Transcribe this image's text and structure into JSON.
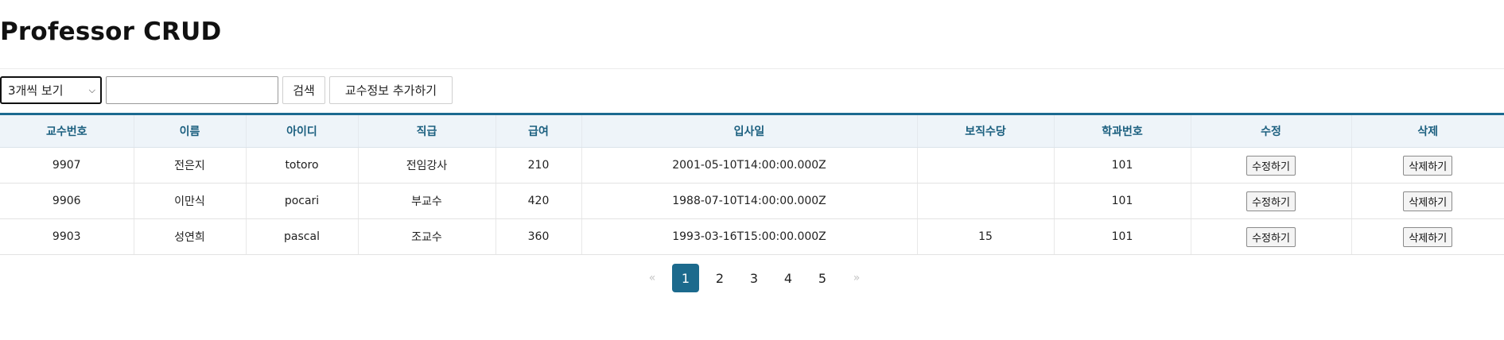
{
  "page": {
    "title": "Professor CRUD"
  },
  "toolbar": {
    "page_size": "3개씩 보기",
    "search_value": "",
    "search_label": "검색",
    "add_label": "교수정보 추가하기"
  },
  "table": {
    "columns": [
      "교수번호",
      "이름",
      "아이디",
      "직급",
      "급여",
      "입사일",
      "보직수당",
      "학과번호",
      "수정",
      "삭제"
    ],
    "rows": [
      {
        "id": "9907",
        "name": "전은지",
        "userid": "totoro",
        "position": "전임강사",
        "salary": "210",
        "hiredate": "2001-05-10T14:00:00.000Z",
        "comm": "",
        "deptno": "101",
        "edit": "수정하기",
        "delete": "삭제하기"
      },
      {
        "id": "9906",
        "name": "이만식",
        "userid": "pocari",
        "position": "부교수",
        "salary": "420",
        "hiredate": "1988-07-10T14:00:00.000Z",
        "comm": "",
        "deptno": "101",
        "edit": "수정하기",
        "delete": "삭제하기"
      },
      {
        "id": "9903",
        "name": "성연희",
        "userid": "pascal",
        "position": "조교수",
        "salary": "360",
        "hiredate": "1993-03-16T15:00:00.000Z",
        "comm": "15",
        "deptno": "101",
        "edit": "수정하기",
        "delete": "삭제하기"
      }
    ]
  },
  "pagination": {
    "prev": "«",
    "pages": [
      "1",
      "2",
      "3",
      "4",
      "5"
    ],
    "next": "»",
    "current": "1"
  },
  "colors": {
    "accent": "#1c6a8d",
    "header_bg": "#eef4f9",
    "header_text": "#1b5f7f"
  }
}
